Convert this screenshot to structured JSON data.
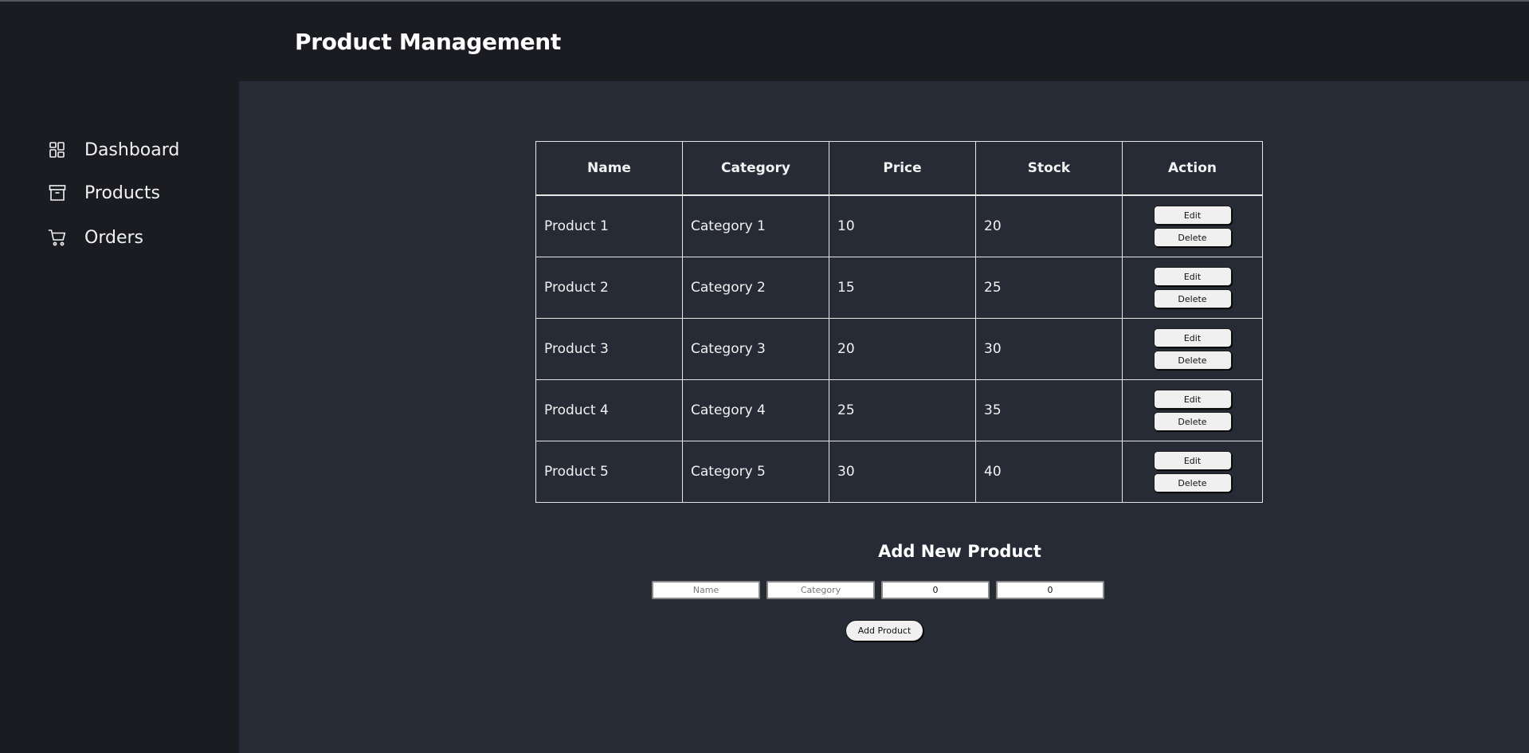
{
  "header": {
    "title": "Product Management"
  },
  "sidebar": {
    "items": [
      {
        "label": "Dashboard",
        "icon": "dashboard-icon"
      },
      {
        "label": "Products",
        "icon": "archive-box-icon"
      },
      {
        "label": "Orders",
        "icon": "cart-icon"
      }
    ]
  },
  "table": {
    "headers": [
      "Name",
      "Category",
      "Price",
      "Stock",
      "Action"
    ],
    "rows": [
      [
        "Product 1",
        "Category 1",
        "10",
        "20"
      ],
      [
        "Product 2",
        "Category 2",
        "15",
        "25"
      ],
      [
        "Product 3",
        "Category 3",
        "20",
        "30"
      ],
      [
        "Product 4",
        "Category 4",
        "25",
        "35"
      ],
      [
        "Product 5",
        "Category 5",
        "30",
        "40"
      ]
    ],
    "edit_label": "Edit",
    "delete_label": "Delete"
  },
  "form": {
    "title": "Add New Product",
    "name_placeholder": "Name",
    "category_placeholder": "Category",
    "price_value": "0",
    "stock_value": "0",
    "submit_label": "Add Product"
  },
  "colors": {
    "sidebar_bg": "#1b1c21",
    "main_bg": "#272b35",
    "text": "#f2f2f2"
  }
}
